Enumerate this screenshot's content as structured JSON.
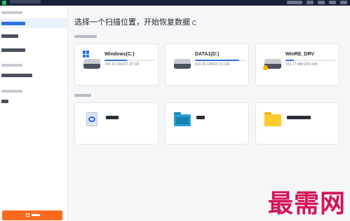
{
  "main": {
    "heading": "选择一个扫描位置，开始恢复数据"
  },
  "drives": [
    {
      "name": "Windows(C:)",
      "size": "104.13 GB/237.25 GB",
      "usage": 0.44,
      "icon": "windows-drive-icon"
    },
    {
      "name": "DATA1(D:)",
      "size": "816.06 GB/931.51 GB",
      "usage": 0.88,
      "icon": "hard-drive-icon"
    },
    {
      "name": "WinRE_DRV",
      "size": "162.17 MB/1000 MB",
      "usage": 0.16,
      "icon": "hard-drive-warning-icon"
    }
  ],
  "folders": [
    {
      "icon": "recycle-bin-icon"
    },
    {
      "icon": "desktop-folder-icon"
    },
    {
      "icon": "folder-icon"
    }
  ],
  "watermark": "最需网",
  "colors": {
    "accent": "#2f6fe0",
    "recover_button": "#ff6a1f",
    "titlebar": "#16213a",
    "watermark": "#d4145a"
  }
}
